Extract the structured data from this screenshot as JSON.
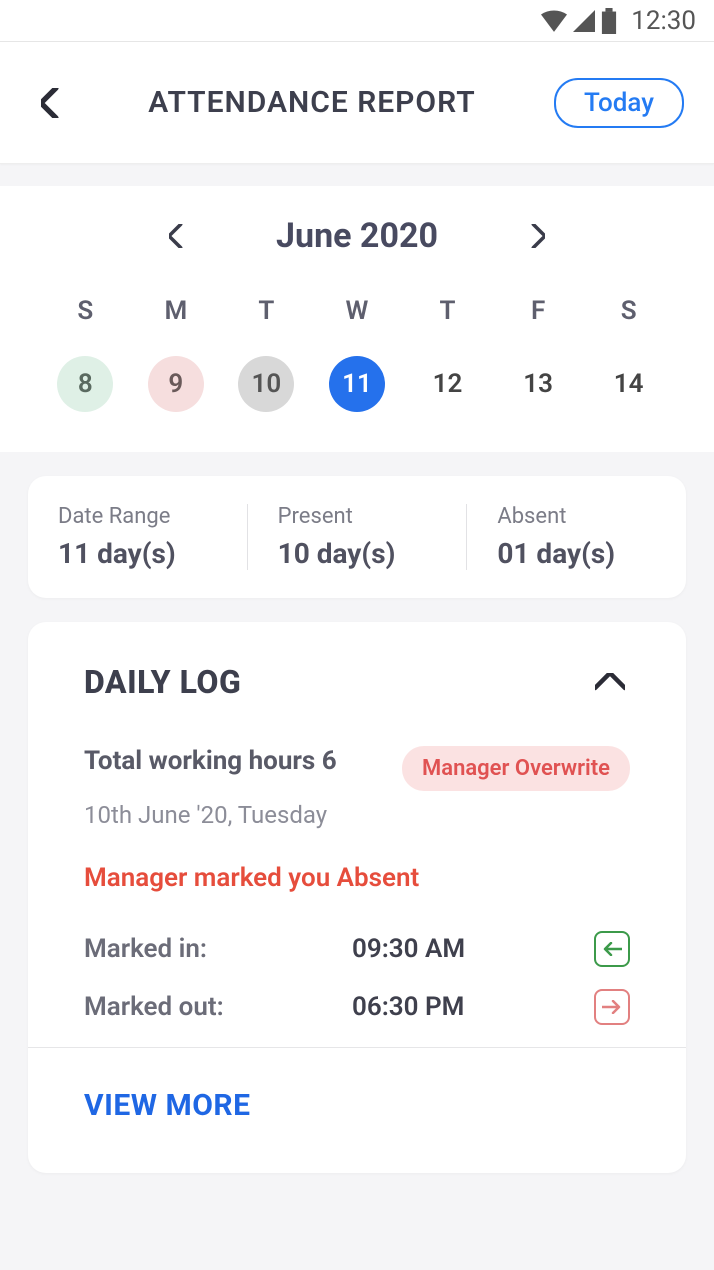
{
  "status_bar": {
    "time": "12:30"
  },
  "header": {
    "title": "ATTENDANCE REPORT",
    "today_label": "Today"
  },
  "calendar": {
    "month_label": "June 2020",
    "dow": [
      "S",
      "M",
      "T",
      "W",
      "T",
      "F",
      "S"
    ],
    "days": [
      {
        "n": "8",
        "cls": "green"
      },
      {
        "n": "9",
        "cls": "pink"
      },
      {
        "n": "10",
        "cls": "grey"
      },
      {
        "n": "11",
        "cls": "blue"
      },
      {
        "n": "12",
        "cls": ""
      },
      {
        "n": "13",
        "cls": ""
      },
      {
        "n": "14",
        "cls": ""
      }
    ]
  },
  "summary": {
    "date_range": {
      "label": "Date Range",
      "value": "11 day(s)"
    },
    "present": {
      "label": "Present",
      "value": "10 day(s)"
    },
    "absent": {
      "label": "Absent",
      "value": "01 day(s)"
    }
  },
  "log": {
    "title": "DAILY LOG",
    "total_hours": "Total working hours 6",
    "badge": "Manager Overwrite",
    "date": "10th June '20, Tuesday",
    "absent_msg": "Manager marked you Absent",
    "marked_in_label": "Marked in:",
    "marked_in_time": "09:30 AM",
    "marked_out_label": "Marked out:",
    "marked_out_time": "06:30 PM",
    "view_more": "VIEW MORE"
  }
}
